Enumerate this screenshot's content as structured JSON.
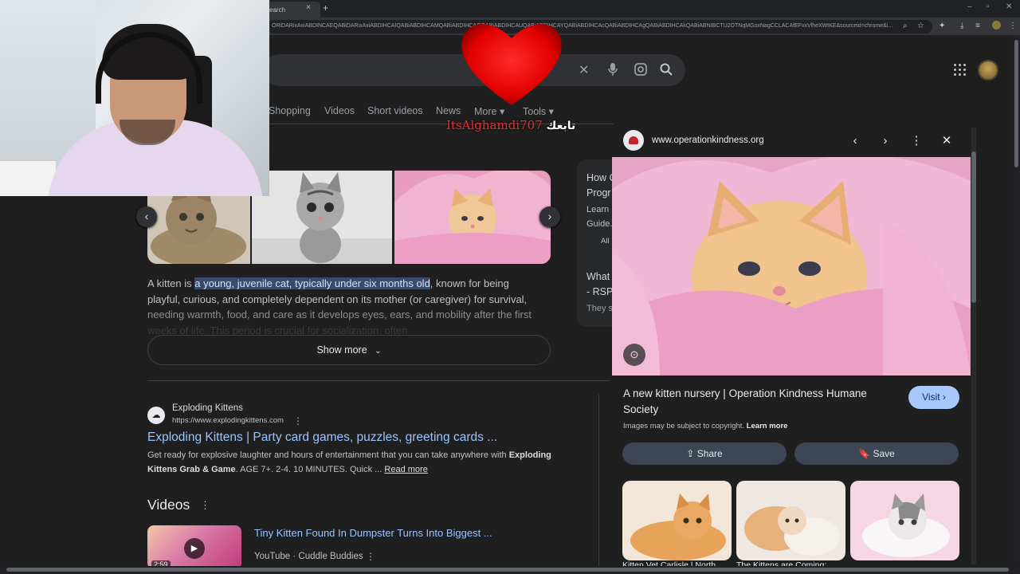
{
  "browser": {
    "tab_title": "earch",
    "tab_close": "×",
    "new_tab": "+",
    "address": "ORiDARixAxiABDINCAEQABiDARixAxiABDIHCAIQABiABDIHCAMQABiABDIHCAQQABiABDIHCAUQABiABDIHCAYQABiABDIHCAcQABiABDIHCAgQABiABDIHCAkQABiABNIBCTU2OTNqMGoxNagCCLACAfEFvxVlheXWtKE&sourceid=chrome&i...",
    "minimize": "–",
    "maximize": "▫",
    "close": "✕"
  },
  "search": {
    "clear_icon": "✕",
    "mic_icon": "🎙",
    "lens_icon": "⊙",
    "search_icon": "⌕"
  },
  "nav_tabs": {
    "shopping": "Shopping",
    "videos": "Videos",
    "short_videos": "Short videos",
    "news": "News",
    "more": "More ▾",
    "tools": "Tools ▾"
  },
  "overlay": {
    "name": "ItsAlghamdi707",
    "follow": "تابعك"
  },
  "overview": {
    "prefix": "A kitten is ",
    "highlight": "a young, juvenile cat, typically under six months old",
    "line1_rest": ", known for being",
    "line2": "playful, curious, and completely dependent on its mother (or caregiver) for survival,",
    "line3": "needing warmth, food, and care as it develops eyes, ears, and mobility after the first",
    "line4": "weeks of life. This period is crucial for socialization, often"
  },
  "show_more": "Show more",
  "side_card": {
    "line1": "How C",
    "line2": "Progr",
    "line3": "Learn",
    "line4": "Guide.",
    "line5": "All",
    "line6": "What",
    "line7": "- RSP",
    "line8": "They s"
  },
  "result": {
    "site": "Exploding Kittens",
    "url": "https://www.explodingkittens.com",
    "title": "Exploding Kittens | Party card games, puzzles, greeting cards ...",
    "snippet_a": "Get ready for explosive laughter and hours of entertainment that you can take anywhere with ",
    "snippet_bold1": "Exploding",
    "snippet_bold2": "Kittens Grab & Game",
    "snippet_b": ". AGE 7+. 2-4. 10 MINUTES. Quick ... ",
    "read_more": "Read more"
  },
  "videos": {
    "heading": "Videos",
    "title": "Tiny Kitten Found In Dumpster Turns Into Biggest ...",
    "meta": "YouTube · Cuddle Buddies",
    "duration": "2:59"
  },
  "viewer": {
    "domain": "www.operationkindness.org",
    "title": "A new kitten nursery | Operation Kindness Humane Society",
    "visit": "Visit ›",
    "copyright": "Images may be subject to copyright.",
    "learn_more": "Learn more",
    "share": "Share",
    "save": "Save",
    "captions": [
      "Kitten Vet Carlisle | North ...",
      "The Kittens are Coming: ...",
      ""
    ]
  },
  "icons": {
    "kebab": "⋮",
    "prev": "‹",
    "next": "›"
  }
}
